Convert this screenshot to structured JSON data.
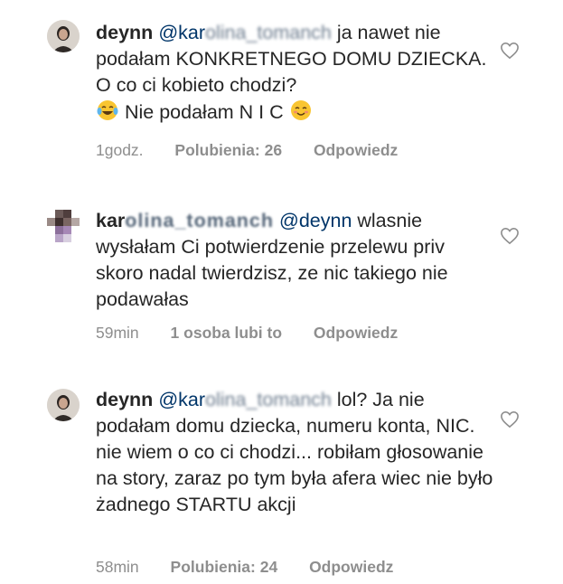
{
  "comments": [
    {
      "username": "deynn",
      "mention": "@kar",
      "mention_blurred": "olina_tomanch",
      "text_first": " ja nawet nie podałam KONKRETNEGO DOMU DZIECKA. O co ci kobieto chodzi?",
      "text_second": " Nie podałam N I C ",
      "emoji_1": "tears-of-joy-emoji",
      "emoji_2": "smiling-blush-emoji",
      "time": "1godz.",
      "likes": "Polubienia: 26",
      "reply": "Odpowiedz"
    },
    {
      "username_visible": "kar",
      "username_blurred": "olina_tomanch",
      "mention": "@deynn",
      "text": " wlasnie wysłałam Ci potwierdzenie przelewu priv skoro nadal twierdzisz, ze nic takiego nie podawałas",
      "time": "59min",
      "likes": "1 osoba lubi to",
      "reply": "Odpowiedz"
    },
    {
      "username": "deynn",
      "mention": "@kar",
      "mention_blurred": "olina_tomanch",
      "text": " lol? Ja nie podałam domu dziecka, numeru konta, NIC. nie wiem o co ci chodzi... robiłam głosowanie na story, zaraz po tym była afera wiec nie było żadnego STARTU akcji",
      "time": "58min",
      "likes": "Polubienia: 24",
      "reply": "Odpowiedz"
    }
  ],
  "icons": {
    "like": "heart-outline-icon",
    "avatar_1": "profile-photo-icon",
    "avatar_2": "pixelated-avatar-icon"
  },
  "colors": {
    "text": "#262626",
    "meta": "#8e8e8e",
    "mention": "#003569"
  }
}
